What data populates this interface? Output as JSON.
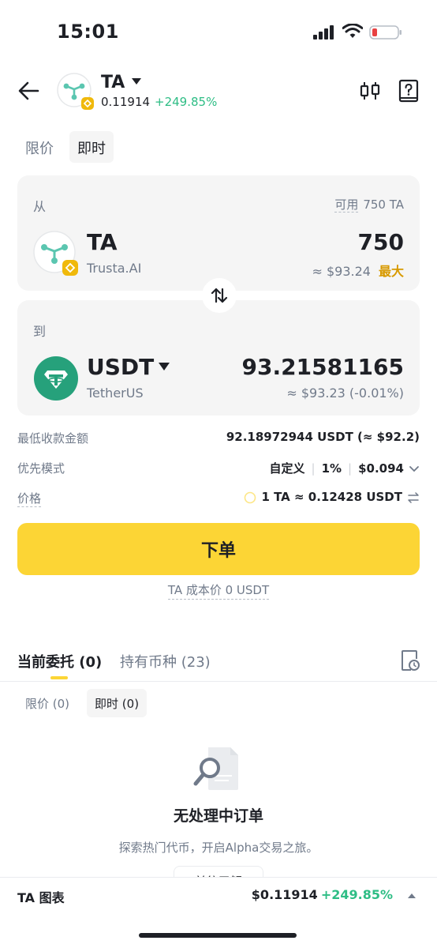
{
  "status_bar": {
    "time": "15:01"
  },
  "header": {
    "token_symbol": "TA",
    "token_price": "0.11914",
    "token_change": "+249.85%"
  },
  "tabs": [
    "限价",
    "即时"
  ],
  "from_card": {
    "label": "从",
    "available_label": "可用",
    "available_value": "750 TA",
    "coin_symbol": "TA",
    "coin_name": "Trusta.AI",
    "amount": "750",
    "amount_usd": "≈ $93.24",
    "max_label": "最大"
  },
  "to_card": {
    "label": "到",
    "coin_symbol": "USDT",
    "coin_name": "TetherUS",
    "amount": "93.21581165",
    "amount_usd": "≈ $93.23 (-0.01%)"
  },
  "info": {
    "min_receive_label": "最低收款金额",
    "min_receive_value": "92.18972944 USDT (≈ $92.2)",
    "priority_label": "优先模式",
    "priority_mode": "自定义",
    "priority_slippage": "1%",
    "priority_fee": "$0.094",
    "price_label": "价格",
    "price_value": "1 TA ≈ 0.12428 USDT"
  },
  "order_button": "下单",
  "cost_basis": "TA 成本价 0 USDT",
  "orders": {
    "tab_open": "当前委托 (0)",
    "tab_holdings": "持有币种 (23)",
    "sub_tab_limit": "限价 (0)",
    "sub_tab_instant": "即时 (0)",
    "empty_title": "无处理中订单",
    "empty_desc": "探索热门代币，开启Alpha交易之旅。",
    "explore_button": "前往了解"
  },
  "bottom_bar": {
    "label": "TA 图表",
    "price": "$0.11914",
    "change": "+249.85%"
  },
  "colors": {
    "accent": "#fcd535",
    "positive": "#2ebd85",
    "max_link": "#d89a00",
    "usdt_brand": "#26a17b",
    "card_bg": "#f5f5f5"
  }
}
